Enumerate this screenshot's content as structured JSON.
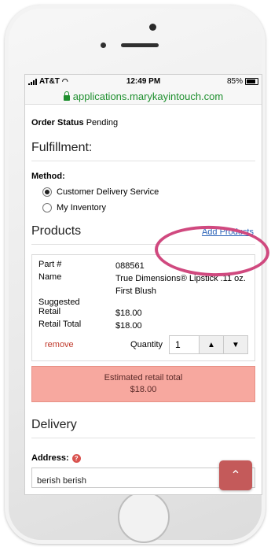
{
  "status_bar": {
    "carrier": "AT&T",
    "time": "12:49 PM",
    "battery": "85%"
  },
  "browser": {
    "url": "applications.marykayintouch.com"
  },
  "order": {
    "status_label": "Order Status",
    "status_value": "Pending"
  },
  "fulfillment": {
    "title": "Fulfillment:",
    "method_label": "Method:",
    "options": [
      {
        "label": "Customer Delivery Service",
        "checked": true
      },
      {
        "label": "My Inventory",
        "checked": false
      }
    ]
  },
  "products": {
    "title": "Products",
    "add_label": "Add Products",
    "item": {
      "part_label": "Part #",
      "part_value": "088561",
      "name_label": "Name",
      "name_value": "True Dimensions® Lipstick .11 oz. First Blush",
      "suggested_label": "Suggested",
      "retail_label": "Retail",
      "retail_value": "$18.00",
      "retail_total_label": "Retail Total",
      "retail_total_value": "$18.00",
      "remove_label": "remove",
      "quantity_label": "Quantity",
      "quantity_value": "1"
    },
    "estimated_label": "Estimated retail total",
    "estimated_value": "$18.00"
  },
  "delivery": {
    "title": "Delivery",
    "address_label": "Address:",
    "address_value": "berish berish"
  },
  "icons": {
    "lock": "lock-icon",
    "wifi": "wifi-icon",
    "battery": "battery-icon",
    "chevron_up": "chevron-up-icon",
    "chevron_down": "chevron-down-icon",
    "help": "help-icon"
  },
  "colors": {
    "url_green": "#1e8f2e",
    "link_blue": "#2a62b8",
    "remove_red": "#c0392b",
    "estimate_bg": "#f7a89f",
    "annotation": "#d0497f",
    "scroll_button": "#c45a5a"
  }
}
